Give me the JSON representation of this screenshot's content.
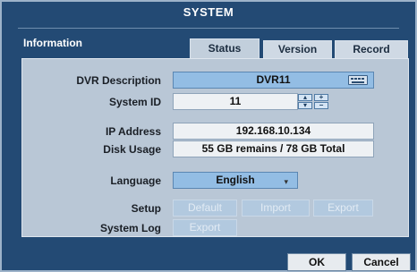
{
  "window": {
    "title": "SYSTEM"
  },
  "section": {
    "label": "Information"
  },
  "tabs": [
    {
      "label": "Status"
    },
    {
      "label": "Version"
    },
    {
      "label": "Record"
    }
  ],
  "fields": {
    "dvr_description": {
      "label": "DVR Description",
      "value": "DVR11"
    },
    "system_id": {
      "label": "System ID",
      "value": "11"
    },
    "ip_address": {
      "label": "IP Address",
      "value": "192.168.10.134"
    },
    "disk_usage": {
      "label": "Disk Usage",
      "value": "55 GB remains  /  78 GB Total"
    },
    "language": {
      "label": "Language",
      "value": "English"
    }
  },
  "setup": {
    "label": "Setup",
    "default_label": "Default",
    "import_label": "Import",
    "export_label": "Export"
  },
  "system_log": {
    "label": "System Log",
    "export_label": "Export"
  },
  "footer": {
    "ok_label": "OK",
    "cancel_label": "Cancel"
  },
  "colors": {
    "background": "#234a74",
    "panel": "#b9c7d6",
    "highlight_field": "#93bde4"
  },
  "icons": {
    "keyboard": "keyboard-icon",
    "spin": "spinner-icon",
    "dropdown": "chevron-down-icon"
  }
}
